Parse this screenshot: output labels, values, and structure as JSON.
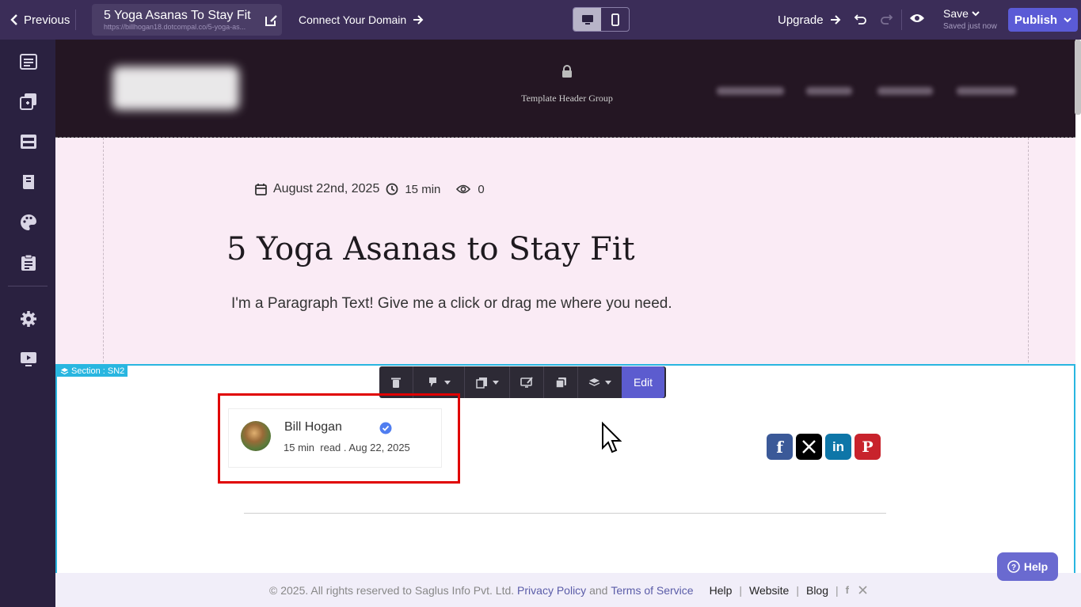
{
  "topbar": {
    "previous_label": "Previous",
    "page_title": "5 Yoga Asanas To Stay Fit",
    "page_url": "https://billhogan18.dotcompal.co/5-yoga-as...",
    "connect_domain_label": "Connect Your Domain",
    "upgrade_label": "Upgrade",
    "save_label": "Save",
    "save_status": "Saved just now",
    "publish_label": "Publish"
  },
  "colors": {
    "topbar_bg": "#3b2d58",
    "sidebar_bg": "#2a2140",
    "publish_bg": "#5b5bd6",
    "selection": "#29b6e0",
    "highlight": "#e00000"
  },
  "sidebar": {
    "icons": [
      "pages-list-icon",
      "add-element-icon",
      "section-layout-icon",
      "book-icon",
      "palette-icon",
      "clipboard-icon",
      "settings-icon",
      "preview-monitor-icon"
    ]
  },
  "header": {
    "lock_label": "Template Header Group"
  },
  "hero": {
    "date": "August 22nd, 2025",
    "read_time": "15 min",
    "views": "0",
    "title": "5 Yoga Asanas to Stay Fit",
    "paragraph": "I'm a Paragraph Text! Give me a click or drag me where you need."
  },
  "section": {
    "label": "Section : SN2",
    "edit_label": "Edit"
  },
  "author": {
    "name": "Bill Hogan",
    "read_time": "15 min",
    "read_word": "read",
    "date": ". Aug 22, 2025"
  },
  "social": [
    {
      "name": "facebook",
      "glyph": "f",
      "color": "#3b5998"
    },
    {
      "name": "x",
      "glyph": "𝕏",
      "color": "#000000"
    },
    {
      "name": "linkedin",
      "glyph": "in",
      "color": "#0e76a8"
    },
    {
      "name": "pinterest",
      "glyph": "P",
      "color": "#c8232c"
    }
  ],
  "footer": {
    "copyright": "©  2025. All rights reserved to Saglus Info Pvt. Ltd.",
    "privacy": "Privacy Policy",
    "and": "and",
    "terms": "Terms of Service",
    "help": "Help",
    "website": "Website",
    "blog": "Blog"
  },
  "help_button": "Help"
}
